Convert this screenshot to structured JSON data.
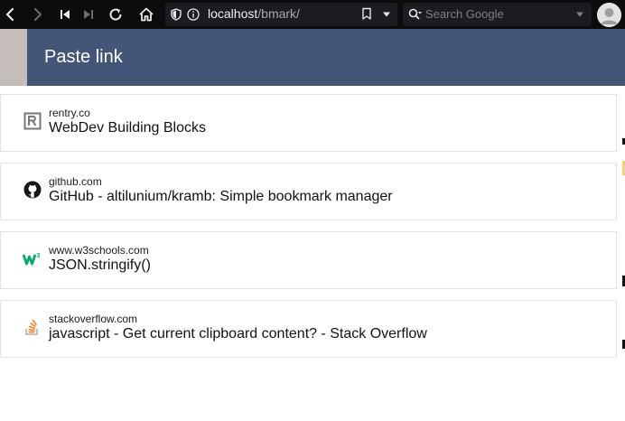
{
  "browser": {
    "url_host": "localhost",
    "url_path": "/bmark/",
    "search_placeholder": "Search Google"
  },
  "header": {
    "title": "Paste link",
    "color": "#435677"
  },
  "bookmarks": [
    {
      "domain": "rentry.co",
      "title": "WebDev Building Blocks",
      "icon": "rentry-icon"
    },
    {
      "domain": "github.com",
      "title": "GitHub - altilunium/kramb: Simple bookmark manager",
      "icon": "github-icon"
    },
    {
      "domain": "www.w3schools.com",
      "title": "JSON.stringify()",
      "icon": "w3schools-icon"
    },
    {
      "domain": "stackoverflow.com",
      "title": "javascript - Get current clipboard content? - Stack Overflow",
      "icon": "stackoverflow-icon"
    }
  ]
}
